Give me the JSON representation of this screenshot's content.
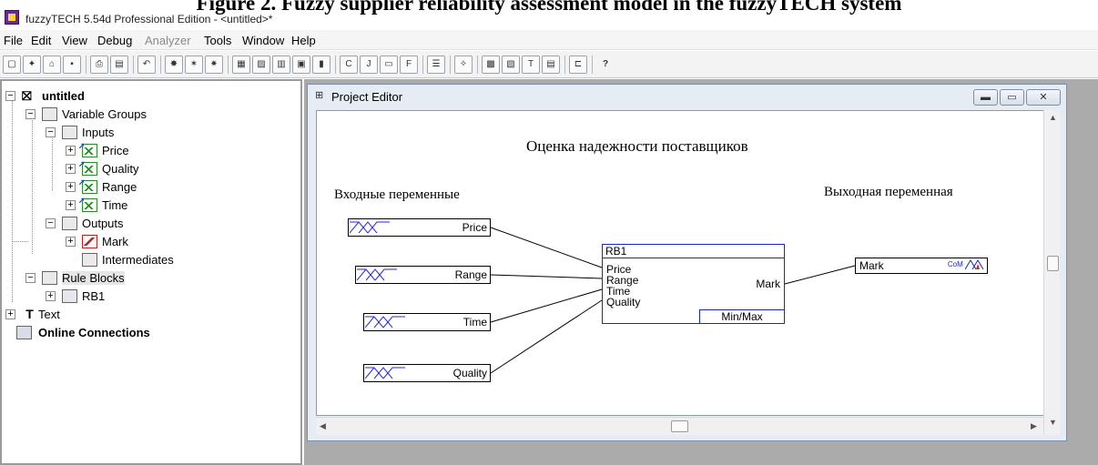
{
  "figure_caption": "Figure 2. Fuzzy supplier reliability assessment model in the fuzzyTECH system",
  "window": {
    "title": "fuzzyTECH 5.54d Professional Edition - <untitled>*"
  },
  "menu": [
    "File",
    "Edit",
    "View",
    "Debug",
    "Analyzer",
    "Tools",
    "Window",
    "Help"
  ],
  "menu_disabled": "Analyzer",
  "toolbar_icons": [
    "new-icon",
    "wizard-icon",
    "open-icon",
    "save-icon",
    "print-icon",
    "print-setup-icon",
    "undo-icon",
    "debug-icon",
    "trace-icon",
    "step-icon",
    "spreadsheet-icon",
    "statistics-icon",
    "time-plot-icon",
    "transfer-plot-icon",
    "3d-plot-icon",
    "compile-c-icon",
    "compile-java-icon",
    "compile-dll-icon",
    "compile-fir-icon",
    "properties-icon",
    "neuro-icon",
    "rule-block-icon",
    "term-icon",
    "text-icon",
    "editor-icon",
    "layout-icon",
    "help-icon"
  ],
  "tree": {
    "root": "untitled",
    "variable_groups": "Variable Groups",
    "inputs": "Inputs",
    "input_items": [
      "Price",
      "Quality",
      "Range",
      "Time"
    ],
    "outputs": "Outputs",
    "output_items": [
      "Mark"
    ],
    "intermediates": "Intermediates",
    "rule_blocks": "Rule Blocks",
    "rule_block_items": [
      "RB1"
    ],
    "text": "Text",
    "online": "Online Connections"
  },
  "project_editor": {
    "title": "Project Editor",
    "heading": "Оценка надежности поставщиков",
    "inputs_label": "Входные переменные",
    "output_label": "Выходная переменная",
    "input_vars": [
      "Price",
      "Range",
      "Time",
      "Quality"
    ],
    "rule_block": {
      "name": "RB1",
      "inputs": [
        "Price",
        "Range",
        "Time",
        "Quality"
      ],
      "output": "Mark",
      "operator": "Min/Max"
    },
    "output_var": "Mark",
    "defuzz_label": "CoM"
  }
}
